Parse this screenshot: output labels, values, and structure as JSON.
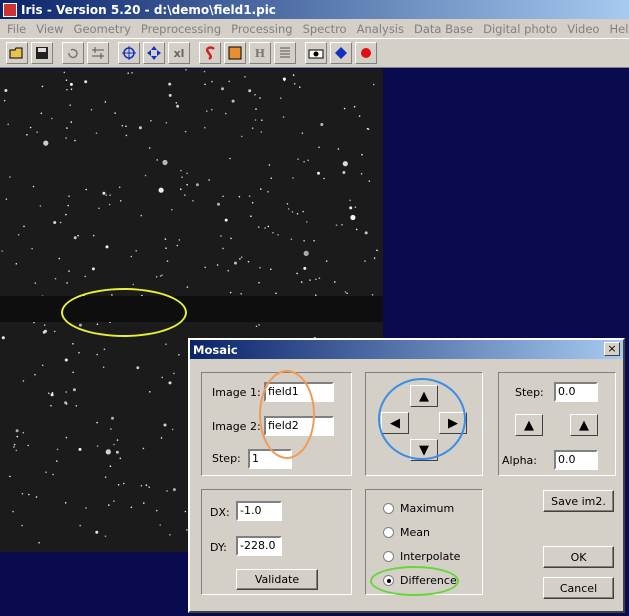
{
  "window": {
    "title": "Iris - Version 5.20 - d:\\demo\\field1.pic"
  },
  "menu": [
    "File",
    "View",
    "Geometry",
    "Preprocessing",
    "Processing",
    "Spectro",
    "Analysis",
    "Data Base",
    "Digital photo",
    "Video",
    "Help"
  ],
  "toolbar": {
    "buttons": [
      "open-icon",
      "save-icon",
      "undo-icon",
      "settings-icon",
      "crosshair-icon",
      "move-icon",
      "xl-label",
      "red-s-icon",
      "orange-box-icon",
      "h-label",
      "list-icon",
      "camera-icon",
      "blue-dots-icon",
      "record-icon"
    ],
    "xl_label": "xl",
    "h_label": "H"
  },
  "dialog": {
    "title": "Mosaic",
    "close_label": "×",
    "image1_label": "Image 1:",
    "image1_value": "field1",
    "image2_label": "Image 2:",
    "image2_value": "field2",
    "step_label": "Step:",
    "step_value": "1",
    "dx_label": "DX:",
    "dx_value": "-1.0",
    "dy_label": "DY:",
    "dy_value": "-228.0",
    "validate_label": "Validate",
    "right_step_label": "Step:",
    "right_step_value": "0.0",
    "alpha_label": "Alpha:",
    "alpha_value": "0.0",
    "save_label": "Save im2.",
    "ok_label": "OK",
    "cancel_label": "Cancel",
    "options": [
      "Maximum",
      "Mean",
      "Interpolate",
      "Difference"
    ],
    "selected_option": "Difference"
  },
  "colors": {
    "annotation_yellow": "#e6ef3a",
    "annotation_orange": "#f09a55",
    "annotation_blue": "#3a8ee6",
    "annotation_green": "#66d63a",
    "desktop_background": "#0a0a4e"
  }
}
